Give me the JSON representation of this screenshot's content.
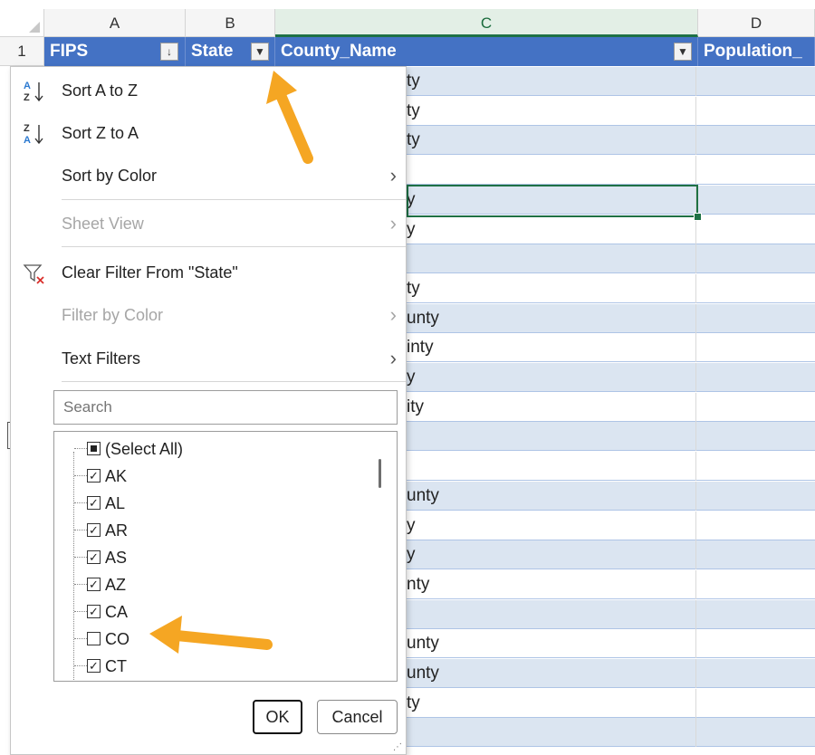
{
  "columns": [
    "A",
    "B",
    "C",
    "D"
  ],
  "row_number": "1",
  "header_cells": {
    "fips": "FIPS",
    "state": "State",
    "county_name": "County_Name",
    "population": "Population_"
  },
  "data_fragments": [
    "ty",
    "ty",
    "ty",
    "",
    "y",
    "y",
    "",
    "ty",
    "unty",
    "inty",
    "y",
    "ity",
    "",
    "",
    "unty",
    "y",
    "y",
    "nty",
    "",
    "unty",
    "unty",
    "ty",
    ""
  ],
  "menu": {
    "sort_az": "Sort A to Z",
    "sort_za": "Sort Z to A",
    "sort_by_color": "Sort by Color",
    "sheet_view": "Sheet View",
    "clear_filter": "Clear Filter From \"State\"",
    "filter_by_color": "Filter by Color",
    "text_filters": "Text Filters"
  },
  "search": {
    "placeholder": "Search"
  },
  "list_items": [
    {
      "label": "(Select All)",
      "state": "mixed"
    },
    {
      "label": "AK",
      "state": "checked"
    },
    {
      "label": "AL",
      "state": "checked"
    },
    {
      "label": "AR",
      "state": "checked"
    },
    {
      "label": "AS",
      "state": "checked"
    },
    {
      "label": "AZ",
      "state": "checked"
    },
    {
      "label": "CA",
      "state": "checked"
    },
    {
      "label": "CO",
      "state": "unchecked"
    },
    {
      "label": "CT",
      "state": "checked"
    }
  ],
  "buttons": {
    "ok": "OK",
    "cancel": "Cancel"
  },
  "colors": {
    "header_fill": "#4472c4",
    "band_fill": "#dbe5f1",
    "selection": "#1e7145",
    "annotation_arrow": "#f5a623"
  }
}
